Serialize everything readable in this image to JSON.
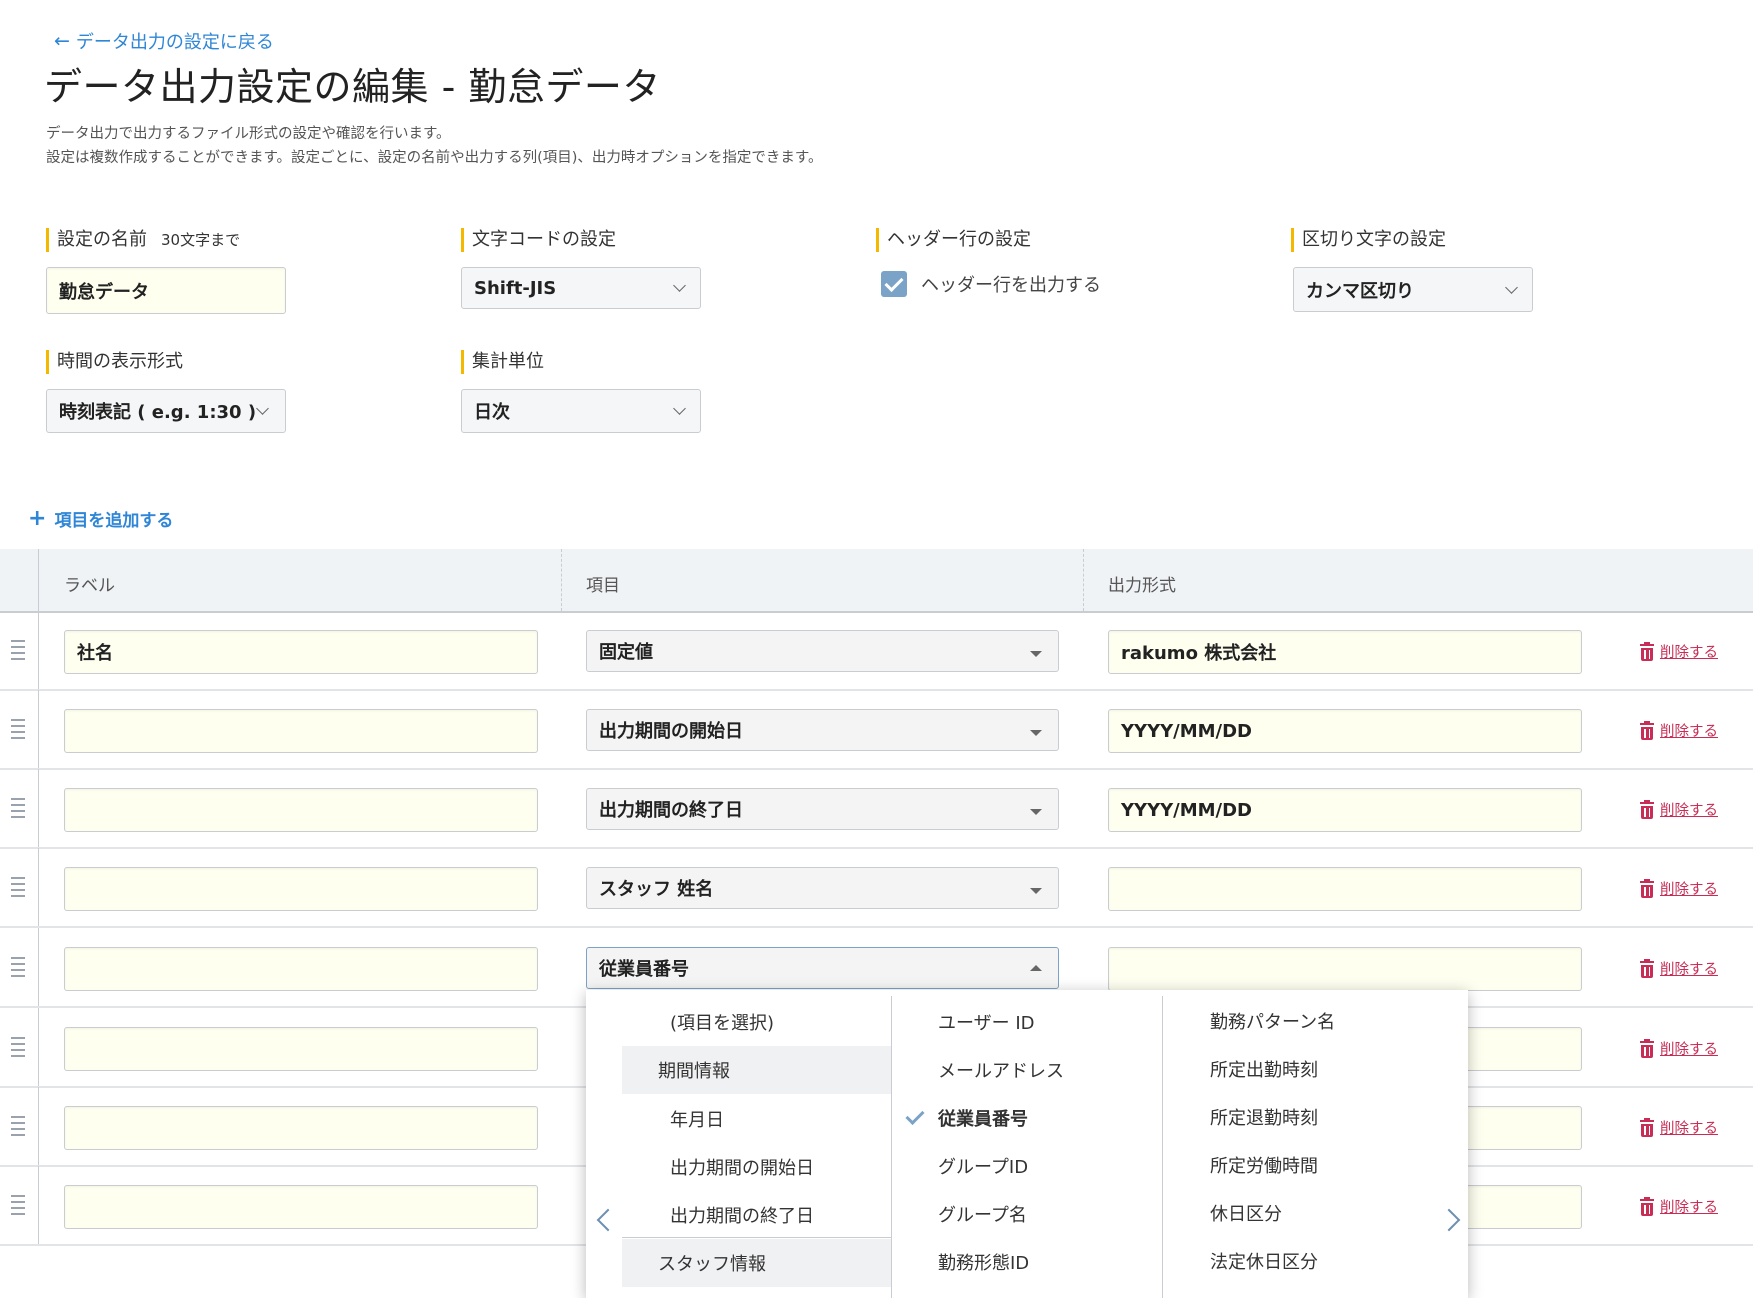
{
  "header": {
    "back_label": "データ出力の設定に戻る",
    "title": "データ出力設定の編集 - 勤怠データ",
    "desc1": "データ出力で出力するファイル形式の設定や確認を行います。",
    "desc2": "設定は複数作成することができます。設定ごとに、設定の名前や出力する列(項目)、出力時オプションを指定できます。"
  },
  "settings": {
    "name_label": "設定の名前",
    "name_note": "30文字まで",
    "name_value": "勤怠データ",
    "encoding_label": "文字コードの設定",
    "encoding_value": "Shift-JIS",
    "header_row_label": "ヘッダー行の設定",
    "header_row_checkbox": "ヘッダー行を出力する",
    "header_row_checked": true,
    "delimiter_label": "区切り文字の設定",
    "delimiter_value": "カンマ区切り",
    "time_format_label": "時間の表示形式",
    "time_format_value": "時刻表記 ( e.g. 1:30 )",
    "aggregation_label": "集計単位",
    "aggregation_value": "日次"
  },
  "add_item_label": "項目を追加する",
  "table": {
    "columns": [
      "ラベル",
      "項目",
      "出力形式"
    ],
    "delete_label": "削除する",
    "rows": [
      {
        "label": "社名",
        "item": "固定値",
        "format": "rakumo 株式会社"
      },
      {
        "label": "",
        "item": "出力期間の開始日",
        "format": "YYYY/MM/DD"
      },
      {
        "label": "",
        "item": "出力期間の終了日",
        "format": "YYYY/MM/DD"
      },
      {
        "label": "",
        "item": "スタッフ 姓名",
        "format": ""
      },
      {
        "label": "",
        "item": "従業員番号",
        "format": ""
      },
      {
        "label": "",
        "item": "",
        "format": ""
      },
      {
        "label": "",
        "item": "",
        "format": ""
      },
      {
        "label": "",
        "item": "",
        "format": ""
      }
    ]
  },
  "dropdown": {
    "col1": {
      "placeholder": "(項目を選択)",
      "group1": "期間情報",
      "items": [
        "年月日",
        "出力期間の開始日",
        "出力期間の終了日"
      ],
      "group2": "スタッフ情報"
    },
    "col2": [
      "ユーザー ID",
      "メールアドレス",
      "従業員番号",
      "グループID",
      "グループ名",
      "勤務形態ID"
    ],
    "col2_selected": "従業員番号",
    "col3": [
      "勤務パターン名",
      "所定出勤時刻",
      "所定退勤時刻",
      "所定労働時間",
      "休日区分",
      "法定休日区分"
    ]
  },
  "colors": {
    "accent": "#2f86d6",
    "required_bar": "#f5b800",
    "delete": "#c72d55",
    "input_bg": "#fffff0"
  }
}
